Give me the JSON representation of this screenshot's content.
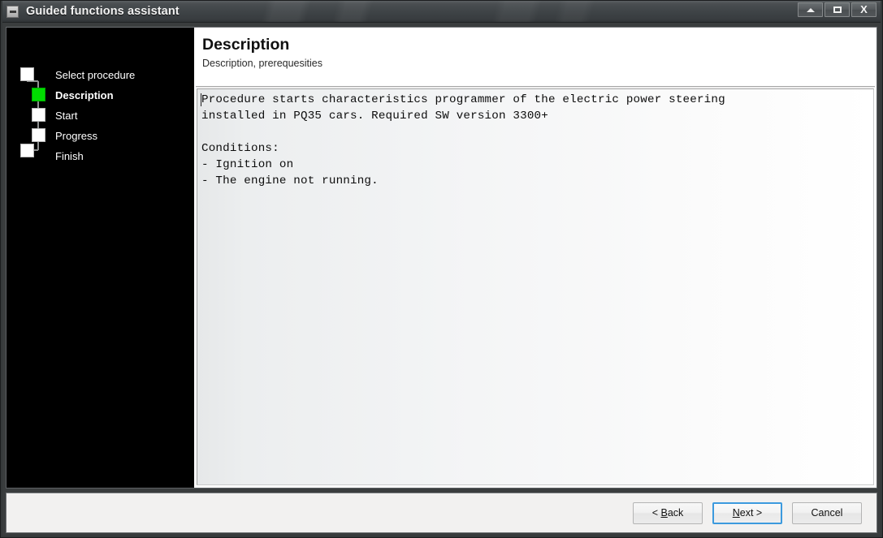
{
  "window": {
    "title": "Guided functions assistant",
    "icon": "minimize-box-icon",
    "controls": [
      {
        "name": "minimize-button",
        "glyph": "▲",
        "label": "Minimize"
      },
      {
        "name": "maximize-button",
        "glyph": "❐",
        "label": "Maximize"
      },
      {
        "name": "close-button",
        "glyph": "X",
        "label": "Close"
      }
    ]
  },
  "sidebar": {
    "background_color": "#000000",
    "active_color": "#00dd00",
    "items": [
      {
        "label": "Select procedure",
        "state": "pending",
        "level": 0
      },
      {
        "label": "Description",
        "state": "current",
        "level": 1
      },
      {
        "label": "Start",
        "state": "pending",
        "level": 1
      },
      {
        "label": "Progress",
        "state": "pending",
        "level": 1
      },
      {
        "label": "Finish",
        "state": "pending",
        "level": 0
      }
    ]
  },
  "content": {
    "title": "Description",
    "subtitle": "Description, prerequesities",
    "description_text": "Procedure starts characteristics programmer of the electric power steering\ninstalled in PQ35 cars. Required SW version 3300+\n\nConditions:\n- Ignition on\n- The engine not running."
  },
  "footer": {
    "buttons": [
      {
        "name": "back-button",
        "label": "< Back",
        "accel_prefix": "< ",
        "accel_char": "B",
        "accel_suffix": "ack",
        "focused": false
      },
      {
        "name": "next-button",
        "label": "Next >",
        "accel_prefix": "",
        "accel_char": "N",
        "accel_suffix": "ext >",
        "focused": true
      },
      {
        "name": "cancel-button",
        "label": "Cancel",
        "accel_prefix": "",
        "accel_char": "",
        "accel_suffix": "Cancel",
        "focused": false
      }
    ]
  }
}
